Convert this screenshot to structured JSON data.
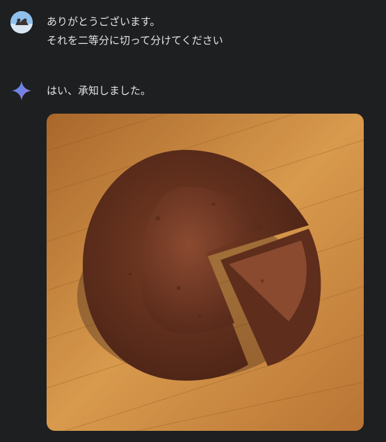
{
  "conversation": {
    "user_message": {
      "line1": "ありがとうございます。",
      "line2": "それを二等分に切って分けてください"
    },
    "assistant_message": {
      "text": "はい、承知しました。"
    }
  },
  "icons": {
    "user_avatar": "avatar",
    "assistant_avatar": "sparkle-icon"
  },
  "colors": {
    "background": "#1e1f20",
    "text": "#e3e3e3"
  }
}
